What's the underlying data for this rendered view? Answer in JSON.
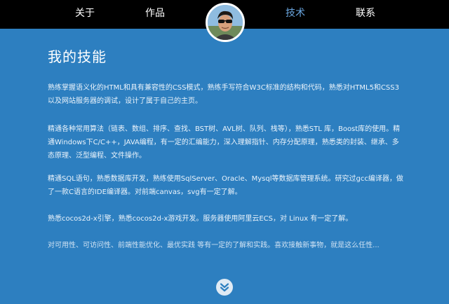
{
  "nav": {
    "about": "关于",
    "works": "作品",
    "tech": "技术",
    "contact": "联系"
  },
  "main": {
    "title": "我的技能",
    "paragraphs": [
      "熟练掌握语义化的HTML和具有兼容性的CSS模式，熟练手写符合W3C标准的结构和代码，熟悉对HTML5和CSS3以及网站服务器的调试，设计了属于自己的主页。",
      "精通各种常用算法（链表、数组、排序、查找、BST树、AVL树、队列、栈等），熟悉STL 库，Boost库的使用。精通Windows下C/C++，JAVA编程，有一定的汇编能力，深入理解指针、内存分配原理，熟悉类的封装、继承、多态原理、泛型编程、文件操作。",
      "精通SQL语句，熟悉数据库开发，熟练使用SqlServer、Oracle、Mysql等数据库管理系统。研究过gcc编译器，做了一款C语言的IDE编译器。对前端canvas，svg有一定了解。",
      "熟悉cocos2d-x引擎，熟悉cocos2d-x游戏开发。服务器使用阿里云ECS，对 Linux 有一定了解。",
      "对可用性、可访问性、前端性能优化、最优实践 等有一定的了解和实践。喜欢接触新事物，就是这么任性..."
    ]
  },
  "icons": {
    "avatar": "avatar-photo",
    "scroll": "double-chevron-down-icon"
  },
  "colors": {
    "background": "#2d7fc0",
    "topbar": "#000000",
    "nav_active": "#6aa6e0",
    "text": "#ffffff"
  }
}
